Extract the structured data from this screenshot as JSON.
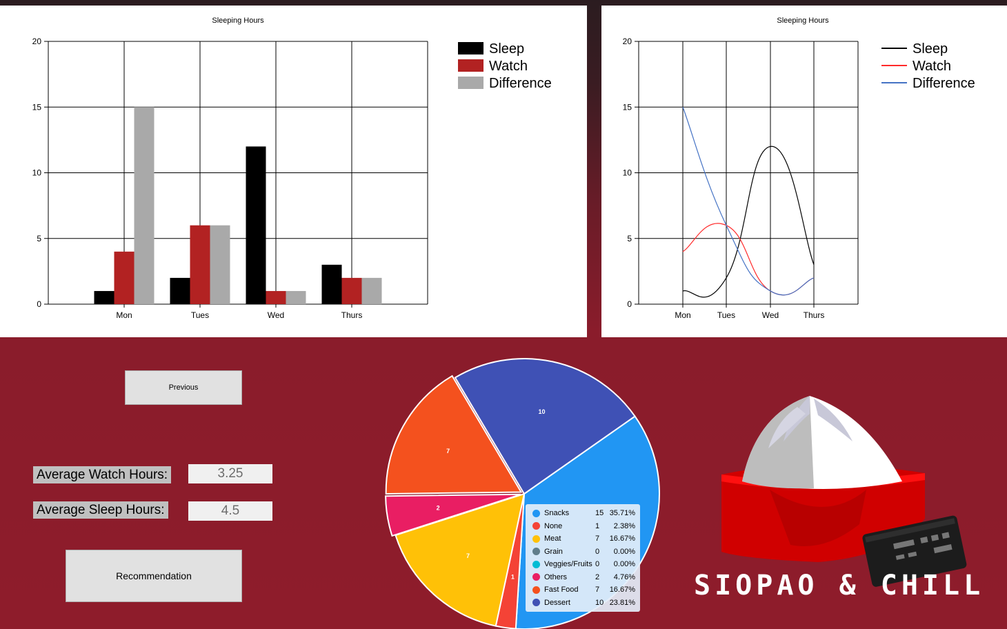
{
  "bar_chart": {
    "title": "Sleeping Hours",
    "y_ticks": [
      "0",
      "5",
      "10",
      "15",
      "20"
    ],
    "legend": [
      "Sleep",
      "Watch",
      "Difference"
    ]
  },
  "line_chart": {
    "title": "Sleeping Hours",
    "y_ticks": [
      "0",
      "5",
      "10",
      "15",
      "20"
    ],
    "legend": [
      "Sleep",
      "Watch",
      "Difference"
    ]
  },
  "buttons": {
    "previous": "Previous",
    "recommendation": "Recommendation"
  },
  "stats": {
    "watch_label": "Average Watch Hours:",
    "watch_value": "3.25",
    "sleep_label": "Average Sleep Hours:",
    "sleep_value": "4.5"
  },
  "pie_legend": [
    {
      "name": "Snacks",
      "count": "15",
      "pct": "35.71%",
      "color": "#2196f3"
    },
    {
      "name": "None",
      "count": "1",
      "pct": "2.38%",
      "color": "#f44336"
    },
    {
      "name": "Meat",
      "count": "7",
      "pct": "16.67%",
      "color": "#ffc107"
    },
    {
      "name": "Grain",
      "count": "0",
      "pct": "0.00%",
      "color": "#607d8b"
    },
    {
      "name": "Veggies/Fruits",
      "count": "0",
      "pct": "0.00%",
      "color": "#00bcd4"
    },
    {
      "name": "Others",
      "count": "2",
      "pct": "4.76%",
      "color": "#e91e63"
    },
    {
      "name": "Fast Food",
      "count": "7",
      "pct": "16.67%",
      "color": "#f4511e"
    },
    {
      "name": "Dessert",
      "count": "10",
      "pct": "23.81%",
      "color": "#3f51b5"
    }
  ],
  "logo": {
    "text": "SIOPAO & CHILL"
  },
  "colors": {
    "sleep": "#000000",
    "watch": "#b22222",
    "difference": "#a9a9a9",
    "line_watch": "#ff2a2a",
    "line_difference": "#4472c4"
  },
  "chart_data": [
    {
      "type": "bar",
      "title": "Sleeping Hours",
      "categories": [
        "Mon",
        "Tues",
        "Wed",
        "Thurs"
      ],
      "series": [
        {
          "name": "Sleep",
          "values": [
            1,
            2,
            12,
            3
          ]
        },
        {
          "name": "Watch",
          "values": [
            4,
            6,
            1,
            2
          ]
        },
        {
          "name": "Difference",
          "values": [
            15,
            6,
            1,
            2
          ]
        }
      ],
      "ylim": [
        0,
        20
      ],
      "grid": true,
      "legend": "top-right"
    },
    {
      "type": "line",
      "title": "Sleeping Hours",
      "categories": [
        "Mon",
        "Tues",
        "Wed",
        "Thurs"
      ],
      "series": [
        {
          "name": "Sleep",
          "values": [
            1,
            2,
            12,
            3
          ]
        },
        {
          "name": "Watch",
          "values": [
            4,
            6,
            1,
            2
          ]
        },
        {
          "name": "Difference",
          "values": [
            15,
            6,
            1,
            2
          ]
        }
      ],
      "ylim": [
        0,
        20
      ],
      "grid": true,
      "smooth": true,
      "legend": "top-right"
    },
    {
      "type": "pie",
      "labels": [
        "Snacks",
        "None",
        "Meat",
        "Grain",
        "Veggies/Fruits",
        "Others",
        "Fast Food",
        "Dessert"
      ],
      "values": [
        15,
        1,
        7,
        0,
        0,
        2,
        7,
        10
      ],
      "data_labels": [
        "",
        "1",
        "7",
        "",
        "",
        "2",
        "7",
        "10"
      ],
      "exploded": [
        "Others",
        "Fast Food"
      ]
    }
  ]
}
